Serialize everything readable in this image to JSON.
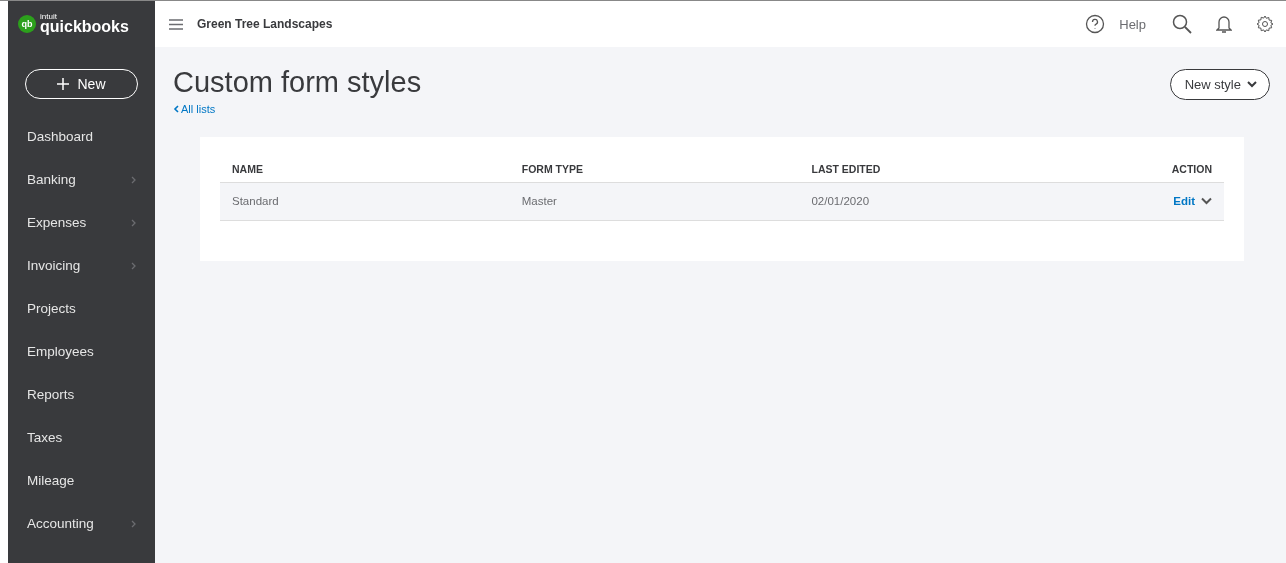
{
  "brand": {
    "mark": "qb",
    "small": "intuit",
    "name": "quickbooks"
  },
  "new_button": {
    "label": "New"
  },
  "sidebar": {
    "items": [
      {
        "label": "Dashboard",
        "expandable": false
      },
      {
        "label": "Banking",
        "expandable": true
      },
      {
        "label": "Expenses",
        "expandable": true
      },
      {
        "label": "Invoicing",
        "expandable": true
      },
      {
        "label": "Projects",
        "expandable": false
      },
      {
        "label": "Employees",
        "expandable": false
      },
      {
        "label": "Reports",
        "expandable": false
      },
      {
        "label": "Taxes",
        "expandable": false
      },
      {
        "label": "Mileage",
        "expandable": false
      },
      {
        "label": "Accounting",
        "expandable": true
      }
    ]
  },
  "topbar": {
    "company": "Green Tree Landscapes",
    "help": "Help"
  },
  "page": {
    "title": "Custom form styles",
    "back_link": "All lists",
    "new_style_button": "New style"
  },
  "table": {
    "columns": [
      "NAME",
      "FORM TYPE",
      "LAST EDITED",
      "ACTION"
    ],
    "rows": [
      {
        "name": "Standard",
        "form_type": "Master",
        "last_edited": "02/01/2020",
        "action": "Edit"
      }
    ]
  }
}
